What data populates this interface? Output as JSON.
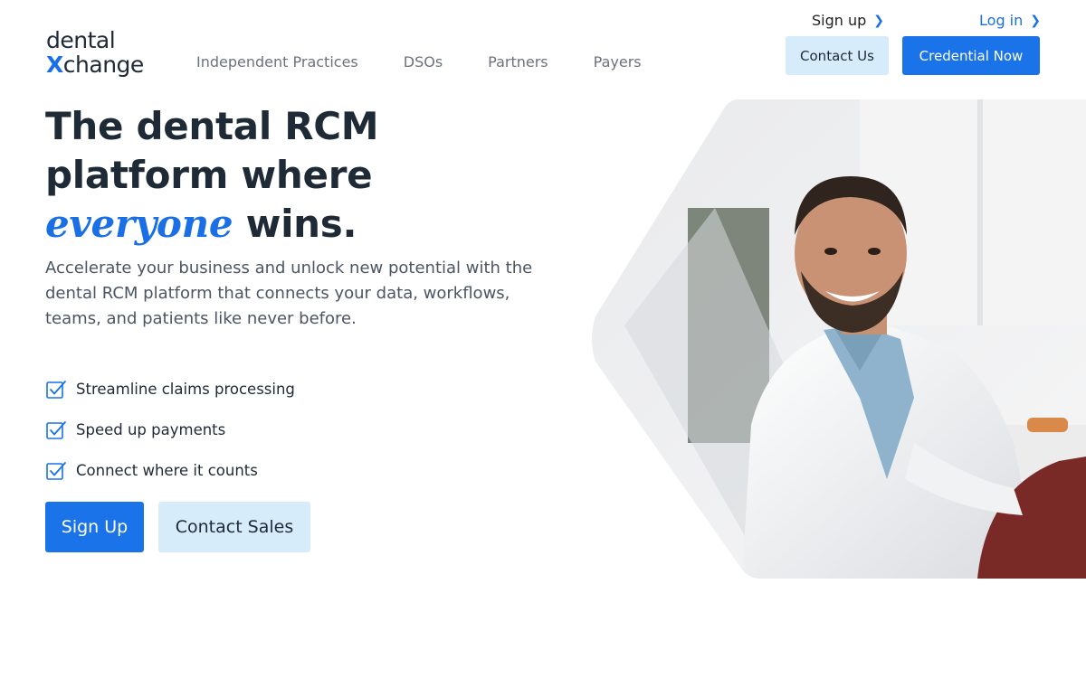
{
  "brand": {
    "logo_line1": "dental",
    "logo_x": "X",
    "logo_rest": "change"
  },
  "nav": [
    "Independent Practices",
    "DSOs",
    "Partners",
    "Payers"
  ],
  "top_links": {
    "signup": "Sign up",
    "login": "Log in",
    "chevron": "❯"
  },
  "header_buttons": {
    "contact_us": "Contact Us",
    "credential_now": "Credential Now"
  },
  "hero": {
    "headline_line1": "The dental RCM",
    "headline_line2": "platform where",
    "headline_accent": "everyone",
    "headline_end": " wins.",
    "subtext": "Accelerate your business and unlock new potential with the dental RCM platform that connects your data, workflows, teams, and patients like never before.",
    "checklist": [
      "Streamline claims processing",
      "Speed up payments",
      "Connect where it counts"
    ],
    "cta_signup": "Sign Up",
    "cta_contact_sales": "Contact Sales"
  },
  "colors": {
    "brand_blue": "#1a73e8",
    "light_blue": "#d6ecfb",
    "text_dark": "#1f2a37",
    "text_muted": "#6b7280"
  },
  "icons": {
    "checklist_icon": "checkbox-check-icon",
    "chevron": "chevron-right-icon"
  }
}
